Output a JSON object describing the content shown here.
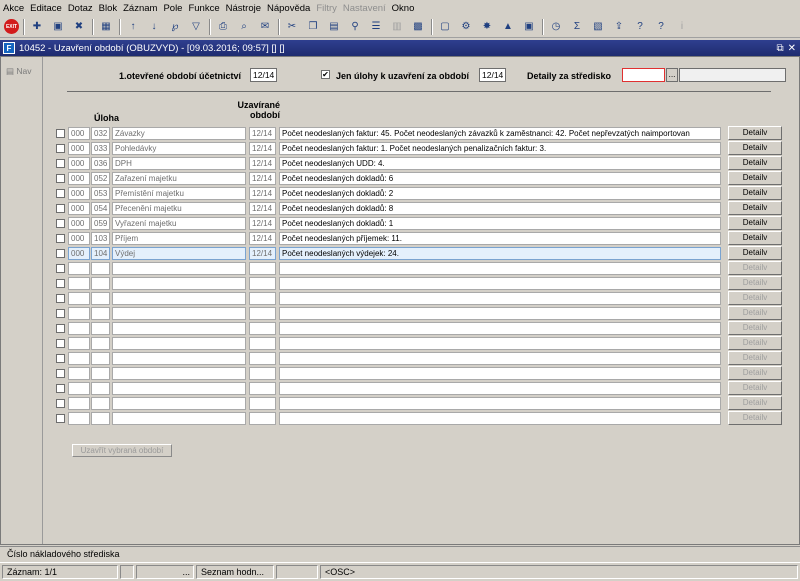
{
  "menu": [
    "Akce",
    "Editace",
    "Dotaz",
    "Blok",
    "Záznam",
    "Pole",
    "Funkce",
    "Nástroje",
    "Nápověda",
    "Filtry",
    "Nastavení",
    "Okno"
  ],
  "menu_disabled": [
    "Filtry",
    "Nastavení"
  ],
  "toolbar": {
    "exit_label": "EXIT",
    "icons": [
      "new-record-icon",
      "save-icon",
      "delete-icon",
      "block-icon",
      "sort-asc-icon",
      "sort-desc-icon",
      "query-icon",
      "filter-icon",
      "print-icon",
      "print-preview-icon",
      "mail-icon",
      "cut-icon",
      "copy-icon",
      "paste-icon",
      "find-icon",
      "list-icon",
      "columns-icon",
      "chart-icon",
      "document-icon",
      "settings-icon",
      "star-icon",
      "warning-icon",
      "note-icon",
      "clock-icon",
      "sum-icon",
      "excel-icon",
      "export-icon",
      "help-icon",
      "question-icon",
      "info-icon"
    ]
  },
  "window": {
    "title": "10452 - Uzavření období (OBUZVYD) - [09.03.2016; 09:57] [] []",
    "app_icon": "F",
    "restore_glyph": "⧉",
    "close_glyph": "✕",
    "nav_label": "Nav"
  },
  "form": {
    "period_label": "1.otevřené období účetnictví",
    "period_value": "12/14",
    "only_tasks_checked": true,
    "only_tasks_label": "Jen úlohy k uzavření za období",
    "only_tasks_value": "12/14",
    "centre_label": "Detaily za středisko",
    "centre_value": "",
    "centre_lov_label": "...",
    "centre_name_value": ""
  },
  "columns": {
    "task": "Úloha",
    "closing_period": "Uzavírané období"
  },
  "rows": [
    {
      "org": "000",
      "code": "032",
      "name": "Závazky",
      "period": "12/14",
      "info": "Počet neodeslaných faktur: 45. Počet neodeslaných závazků k zaměstnanci: 42. Počet nepřevzatých naimportovan",
      "detail": "Detailv",
      "enabled": true
    },
    {
      "org": "000",
      "code": "033",
      "name": "Pohledávky",
      "period": "12/14",
      "info": "Počet neodeslaných faktur: 1. Počet neodeslaných penalizačních faktur: 3.",
      "detail": "Detailv",
      "enabled": true
    },
    {
      "org": "000",
      "code": "036",
      "name": "DPH",
      "period": "12/14",
      "info": "Počet neodeslaných UDD: 4.",
      "detail": "Detailv",
      "enabled": true
    },
    {
      "org": "000",
      "code": "052",
      "name": "Zařazení majetku",
      "period": "12/14",
      "info": "Počet neodeslaných dokladů: 6",
      "detail": "Detailv",
      "enabled": true
    },
    {
      "org": "000",
      "code": "053",
      "name": "Přemístění majetku",
      "period": "12/14",
      "info": "Počet neodeslaných dokladů: 2",
      "detail": "Detailv",
      "enabled": true
    },
    {
      "org": "000",
      "code": "054",
      "name": "Přecenění majetku",
      "period": "12/14",
      "info": "Počet neodeslaných dokladů: 8",
      "detail": "Detailv",
      "enabled": true
    },
    {
      "org": "000",
      "code": "059",
      "name": "Vyřazení majetku",
      "period": "12/14",
      "info": "Počet neodeslaných dokladů: 1",
      "detail": "Detailv",
      "enabled": true
    },
    {
      "org": "000",
      "code": "103",
      "name": "Příjem",
      "period": "12/14",
      "info": "Počet neodeslaných příjemek: 11.",
      "detail": "Detailv",
      "enabled": true
    },
    {
      "org": "000",
      "code": "104",
      "name": "Výdej",
      "period": "12/14",
      "info": "Počet neodeslaných výdejek: 24.",
      "detail": "Detailv",
      "enabled": true,
      "selected": true
    },
    {
      "org": "",
      "code": "",
      "name": "",
      "period": "",
      "info": "",
      "detail": "Detailv",
      "enabled": false
    },
    {
      "org": "",
      "code": "",
      "name": "",
      "period": "",
      "info": "",
      "detail": "Detailv",
      "enabled": false
    },
    {
      "org": "",
      "code": "",
      "name": "",
      "period": "",
      "info": "",
      "detail": "Detailv",
      "enabled": false
    },
    {
      "org": "",
      "code": "",
      "name": "",
      "period": "",
      "info": "",
      "detail": "Detailv",
      "enabled": false
    },
    {
      "org": "",
      "code": "",
      "name": "",
      "period": "",
      "info": "",
      "detail": "Detailv",
      "enabled": false
    },
    {
      "org": "",
      "code": "",
      "name": "",
      "period": "",
      "info": "",
      "detail": "Detailv",
      "enabled": false
    },
    {
      "org": "",
      "code": "",
      "name": "",
      "period": "",
      "info": "",
      "detail": "Detailv",
      "enabled": false
    },
    {
      "org": "",
      "code": "",
      "name": "",
      "period": "",
      "info": "",
      "detail": "Detailv",
      "enabled": false
    },
    {
      "org": "",
      "code": "",
      "name": "",
      "period": "",
      "info": "",
      "detail": "Detailv",
      "enabled": false
    },
    {
      "org": "",
      "code": "",
      "name": "",
      "period": "",
      "info": "",
      "detail": "Detailv",
      "enabled": false
    },
    {
      "org": "",
      "code": "",
      "name": "",
      "period": "",
      "info": "",
      "detail": "Detailv",
      "enabled": false
    }
  ],
  "close_button": "Uzavřít vybraná období",
  "hint": "Číslo nákladového střediska",
  "status": {
    "record": "Záznam: 1/1",
    "ellipsis": "...",
    "list": "Seznam hodn...",
    "mode": "<OSC>"
  }
}
